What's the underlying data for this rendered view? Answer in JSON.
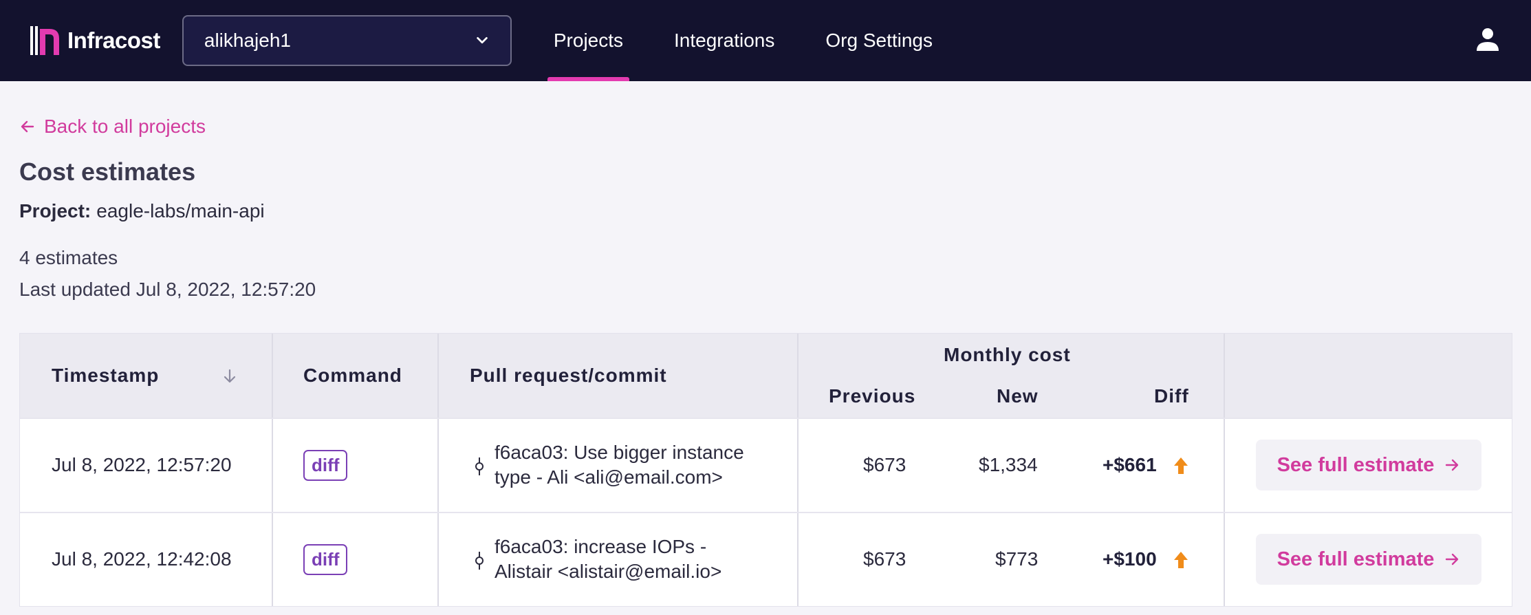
{
  "app": {
    "name": "Infracost"
  },
  "org_select": {
    "value": "alikhajeh1"
  },
  "nav": [
    {
      "label": "Projects",
      "active": true
    },
    {
      "label": "Integrations",
      "active": false
    },
    {
      "label": "Org Settings",
      "active": false
    }
  ],
  "back_link": "Back to all projects",
  "page_title": "Cost estimates",
  "project": {
    "label": "Project:",
    "value": "eagle-labs/main-api"
  },
  "estimate_count": "4 estimates",
  "last_updated": "Last updated Jul 8, 2022, 12:57:20",
  "table": {
    "headers": {
      "timestamp": "Timestamp",
      "command": "Command",
      "pr": "Pull request/commit",
      "monthly_cost": "Monthly cost",
      "previous": "Previous",
      "new": "New",
      "diff": "Diff"
    },
    "rows": [
      {
        "timestamp": "Jul 8, 2022, 12:57:20",
        "command": "diff",
        "commit_line1": "f6aca03: Use bigger instance",
        "commit_line2": "type - Ali <ali@email.com>",
        "previous": "$673",
        "new": "$1,334",
        "diff": "+$661",
        "action": "See full estimate"
      },
      {
        "timestamp": "Jul 8, 2022, 12:42:08",
        "command": "diff",
        "commit_line1": "f6aca03: increase IOPs -",
        "commit_line2": "Alistair <alistair@email.io>",
        "previous": "$673",
        "new": "$773",
        "diff": "+$100",
        "action": "See full estimate"
      }
    ]
  },
  "colors": {
    "accent": "#d13b9d",
    "nav_bg": "#13122e",
    "badge": "#7a3fb5",
    "increase": "#f08c1a"
  }
}
